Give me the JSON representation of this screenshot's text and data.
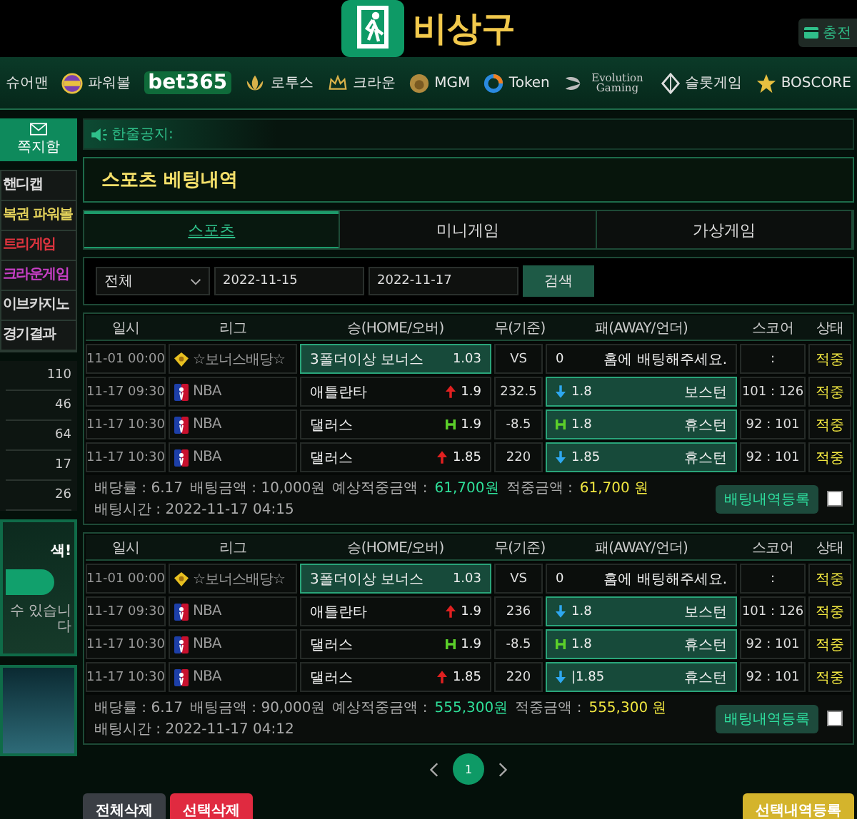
{
  "header": {
    "logo_text": "비상구",
    "charge_button": "충전"
  },
  "nav": [
    {
      "label": "슈어맨",
      "kind": "plain"
    },
    {
      "label": "파워볼",
      "kind": "icon"
    },
    {
      "label": "bet365",
      "kind": "wordmark"
    },
    {
      "label": "로투스",
      "kind": "icon"
    },
    {
      "label": "크라운",
      "kind": "icon"
    },
    {
      "label": "MGM",
      "kind": "icon"
    },
    {
      "label": "Token",
      "kind": "icon"
    },
    {
      "label": "Evolution Gaming",
      "kind": "icon"
    },
    {
      "label": "슬롯게임",
      "kind": "icon"
    },
    {
      "label": "BOSCORE",
      "kind": "icon"
    }
  ],
  "sidebar": {
    "mail": "쪽지함",
    "menu": [
      {
        "label": "핸디캡",
        "color": "#d8d8d8"
      },
      {
        "label": "복권 파워볼",
        "color": "#e0cf5a"
      },
      {
        "label": "트리게임",
        "color": "#e0343f"
      },
      {
        "label": "크라운게임",
        "color": "#c63fc4"
      },
      {
        "label": "이브카지노",
        "color": "#d8d8d8"
      },
      {
        "label": "경기결과",
        "color": "#d8d8d8"
      }
    ],
    "counts": [
      "110",
      "46",
      "64",
      "17",
      "26"
    ],
    "banner": {
      "headline": "색!",
      "note": "수 있습니다"
    }
  },
  "notice": {
    "label": "한줄공지:"
  },
  "title": "스포츠 베팅내역",
  "tabs": [
    {
      "label": "스포츠",
      "selected": true
    },
    {
      "label": "미니게임",
      "selected": false
    },
    {
      "label": "가상게임",
      "selected": false
    }
  ],
  "filter": {
    "select": "전체",
    "date_from": "2022-11-15",
    "date_to": "2022-11-17",
    "search_button": "검색"
  },
  "bets": [
    {
      "columns": [
        "일시",
        "리그",
        "승(HOME/오버)",
        "무(기준)",
        "패(AWAY/언더)",
        "스코어",
        "상태"
      ],
      "rows": [
        {
          "date": "11-01 00:00",
          "league": {
            "kind": "bonus",
            "name": "☆보너스배당☆"
          },
          "home": {
            "team": "3폴더이상 보너스",
            "odds": "1.03",
            "selected": true
          },
          "draw": "VS",
          "away": {
            "odds": "0",
            "team": "홈에 배팅해주세요.",
            "selected": false
          },
          "score": ":",
          "status": "적중"
        },
        {
          "date": "11-17 09:30",
          "league": {
            "kind": "nba",
            "name": "NBA"
          },
          "home": {
            "team": "애틀란타",
            "arrow": {
              "kind": "up"
            },
            "odds": "1.9",
            "selected": false
          },
          "draw": "232.5",
          "away": {
            "arrow": {
              "kind": "down"
            },
            "odds": "1.8",
            "team": "보스턴",
            "selected": true
          },
          "score": "101 : 126",
          "status": "적중"
        },
        {
          "date": "11-17 10:30",
          "league": {
            "kind": "nba",
            "name": "NBA"
          },
          "home": {
            "team": "댈러스",
            "arrow": {
              "kind": "h"
            },
            "odds": "1.9",
            "selected": false
          },
          "draw": "-8.5",
          "away": {
            "arrow": {
              "kind": "h"
            },
            "odds": "1.8",
            "team": "휴스턴",
            "selected": true
          },
          "score": "92 : 101",
          "status": "적중"
        },
        {
          "date": "11-17 10:30",
          "league": {
            "kind": "nba",
            "name": "NBA"
          },
          "home": {
            "team": "댈러스",
            "arrow": {
              "kind": "up"
            },
            "odds": "1.85",
            "selected": false
          },
          "draw": "220",
          "away": {
            "arrow": {
              "kind": "down"
            },
            "odds": "1.85",
            "team": "휴스턴",
            "selected": true
          },
          "score": "92 : 101",
          "status": "적중"
        }
      ],
      "odds": "배당률 : 6.17",
      "stake": "배팅금액 : 10,000원",
      "expected_label": "예상적중금액 :",
      "expected_value": "61,700원",
      "win_label": "적중금액 :",
      "win_value": "61,700 원",
      "time": "배팅시간 : 2022-11-17 04:15",
      "register_button": "배팅내역등록",
      "checked": false
    },
    {
      "columns": [
        "일시",
        "리그",
        "승(HOME/오버)",
        "무(기준)",
        "패(AWAY/언더)",
        "스코어",
        "상태"
      ],
      "rows": [
        {
          "date": "11-01 00:00",
          "league": {
            "kind": "bonus",
            "name": "☆보너스배당☆"
          },
          "home": {
            "team": "3폴더이상 보너스",
            "odds": "1.03",
            "selected": true
          },
          "draw": "VS",
          "away": {
            "odds": "0",
            "team": "홈에 배팅해주세요.",
            "selected": false
          },
          "score": ":",
          "status": "적중"
        },
        {
          "date": "11-17 09:30",
          "league": {
            "kind": "nba",
            "name": "NBA"
          },
          "home": {
            "team": "애틀란타",
            "arrow": {
              "kind": "up"
            },
            "odds": "1.9",
            "selected": false
          },
          "draw": "236",
          "away": {
            "arrow": {
              "kind": "down"
            },
            "odds": "1.8",
            "team": "보스턴",
            "selected": true
          },
          "score": "101 : 126",
          "status": "적중"
        },
        {
          "date": "11-17 10:30",
          "league": {
            "kind": "nba",
            "name": "NBA"
          },
          "home": {
            "team": "댈러스",
            "arrow": {
              "kind": "h"
            },
            "odds": "1.9",
            "selected": false
          },
          "draw": "-8.5",
          "away": {
            "arrow": {
              "kind": "h"
            },
            "odds": "1.8",
            "team": "휴스턴",
            "selected": true
          },
          "score": "92 : 101",
          "status": "적중"
        },
        {
          "date": "11-17 10:30",
          "league": {
            "kind": "nba",
            "name": "NBA"
          },
          "home": {
            "team": "댈러스",
            "arrow": {
              "kind": "up"
            },
            "odds": "1.85",
            "selected": false
          },
          "draw": "220",
          "away": {
            "arrow": {
              "kind": "down"
            },
            "odds": "|1.85",
            "team": "휴스턴",
            "selected": true
          },
          "score": "92 : 101",
          "status": "적중"
        }
      ],
      "odds": "배당률 : 6.17",
      "stake": "배팅금액 : 90,000원",
      "expected_label": "예상적중금액 :",
      "expected_value": "555,300원",
      "win_label": "적중금액 :",
      "win_value": "555,300 원",
      "time": "배팅시간 : 2022-11-17 04:12",
      "register_button": "배팅내역등록",
      "checked": false
    }
  ],
  "pagination": {
    "pages": [
      {
        "label": "1",
        "selected": true
      }
    ]
  },
  "actions": {
    "delete_all": "전체삭제",
    "delete_selected": "선택삭제",
    "register_selected": "선택내역등록"
  }
}
